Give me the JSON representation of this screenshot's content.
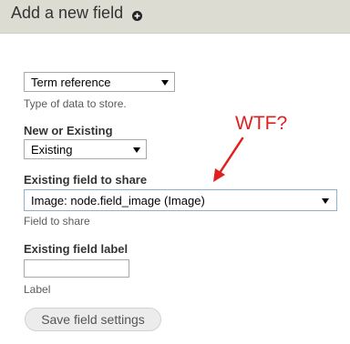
{
  "header": {
    "title": "Add a new field",
    "icon": "add-circle-icon"
  },
  "form": {
    "type_select": {
      "value": "Term reference",
      "description": "Type of data to store."
    },
    "new_or_existing": {
      "label": "New or Existing",
      "value": "Existing"
    },
    "existing_field": {
      "label": "Existing field to share",
      "value": "Image: node.field_image (Image)",
      "description": "Field to share"
    },
    "existing_label": {
      "label": "Existing field label",
      "value": "",
      "description": "Label"
    },
    "save_button": "Save field settings"
  },
  "annotation": {
    "text": "WTF?",
    "color": "#e02020"
  }
}
